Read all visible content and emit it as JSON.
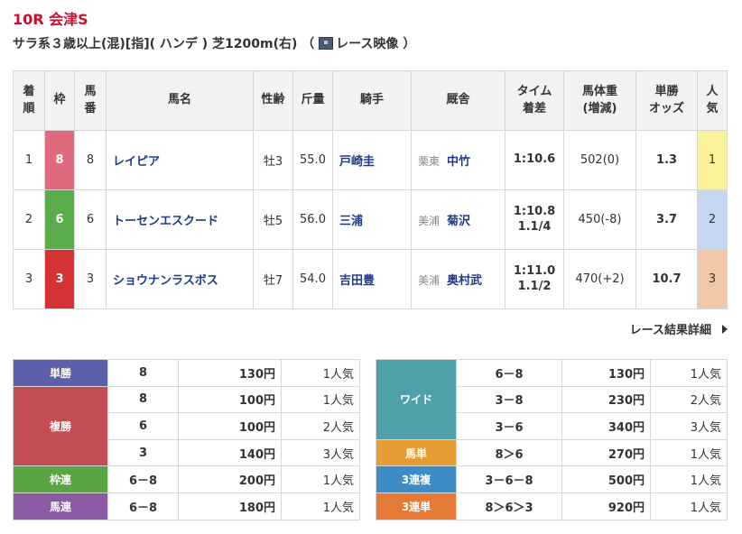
{
  "race": {
    "title": "10R 会津S",
    "conditions": "サラ系３歳以上(混)[指]( ハンデ ) 芝1200m(右) （",
    "video_label": "レース映像",
    "conditions_end": "）"
  },
  "headers": {
    "rank": "着順",
    "waku": "枠",
    "umaban": "馬番",
    "horse": "馬名",
    "sexage": "性齢",
    "weight": "斤量",
    "jockey": "騎手",
    "stable": "厩舎",
    "time": "タイム着差",
    "bodyweight": "馬体重(増減)",
    "odds": "単勝オッズ",
    "popularity": "人気"
  },
  "results": [
    {
      "rank": "1",
      "waku": "8",
      "umaban": "8",
      "horse": "レイピア",
      "sexage": "牡3",
      "weight": "55.0",
      "jockey": "戸崎圭",
      "area": "栗東",
      "trainer": "中竹",
      "time": "1:10.6",
      "margin": "",
      "bodyweight": "502(0)",
      "odds": "1.3",
      "pop": "1"
    },
    {
      "rank": "2",
      "waku": "6",
      "umaban": "6",
      "horse": "トーセンエスクード",
      "sexage": "牡5",
      "weight": "56.0",
      "jockey": "三浦",
      "area": "美浦",
      "trainer": "菊沢",
      "time": "1:10.8",
      "margin": "1.1/4",
      "bodyweight": "450(-8)",
      "odds": "3.7",
      "pop": "2"
    },
    {
      "rank": "3",
      "waku": "3",
      "umaban": "3",
      "horse": "ショウナンラスボス",
      "sexage": "牡7",
      "weight": "54.0",
      "jockey": "吉田豊",
      "area": "美浦",
      "trainer": "奥村武",
      "time": "1:11.0",
      "margin": "1.1/2",
      "bodyweight": "470(+2)",
      "odds": "10.7",
      "pop": "3"
    }
  ],
  "detail_link": "レース結果詳細",
  "payout_left": {
    "tansho": {
      "label": "単勝",
      "combo": "8",
      "amount": "130円",
      "pop": "1人気"
    },
    "fukusho": {
      "label": "複勝",
      "rows": [
        {
          "combo": "8",
          "amount": "100円",
          "pop": "1人気"
        },
        {
          "combo": "6",
          "amount": "100円",
          "pop": "2人気"
        },
        {
          "combo": "3",
          "amount": "140円",
          "pop": "3人気"
        }
      ]
    },
    "wakuren": {
      "label": "枠連",
      "combo": "6－8",
      "amount": "200円",
      "pop": "1人気"
    },
    "umaren": {
      "label": "馬連",
      "combo": "6－8",
      "amount": "180円",
      "pop": "1人気"
    }
  },
  "payout_right": {
    "wide": {
      "label": "ワイド",
      "rows": [
        {
          "combo": "6－8",
          "amount": "130円",
          "pop": "1人気"
        },
        {
          "combo": "3－8",
          "amount": "230円",
          "pop": "2人気"
        },
        {
          "combo": "3－6",
          "amount": "340円",
          "pop": "3人気"
        }
      ]
    },
    "umatan": {
      "label": "馬単",
      "combo": "8＞6",
      "amount": "270円",
      "pop": "1人気"
    },
    "sanrenpuku": {
      "label": "3連複",
      "combo": "3－6－8",
      "amount": "500円",
      "pop": "1人気"
    },
    "sanrentan": {
      "label": "3連単",
      "combo": "8＞6＞3",
      "amount": "920円",
      "pop": "1人気"
    }
  },
  "colors": {
    "title_red": "#c8102e",
    "waku8": "#e06a7d",
    "waku6": "#5aad4b",
    "waku3": "#d63233",
    "pop1": "#fbf39a",
    "pop2": "#c6d8f1",
    "pop3": "#f0c8a8"
  }
}
